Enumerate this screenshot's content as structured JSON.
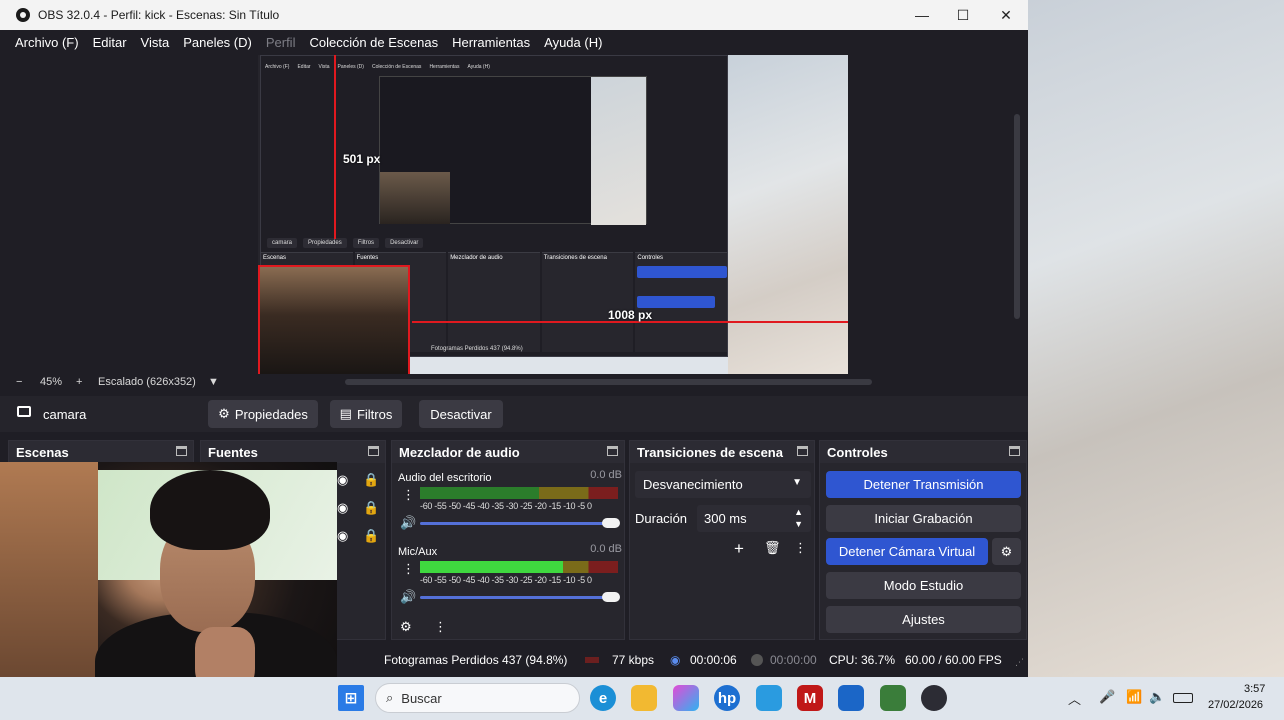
{
  "window": {
    "title": "OBS 32.0.4 - Perfil: kick - Escenas: Sin Título",
    "minimize": "—",
    "maximize": "☐",
    "close": "✕"
  },
  "menu": {
    "items": [
      "Archivo (F)",
      "Editar",
      "Vista",
      "Paneles (D)",
      "Perfil",
      "Colección de Escenas",
      "Herramientas",
      "Ayuda (H)"
    ]
  },
  "preview": {
    "label_top": "501 px",
    "label_right": "1008 px",
    "nested_menu": [
      "Archivo (F)",
      "Editar",
      "Vista",
      "Paneles (D)",
      "Colección de Escenas",
      "Herramientas",
      "Ayuda (H)"
    ],
    "nested_context": [
      "camara",
      "Propiedades",
      "Filtros",
      "Desactivar"
    ],
    "nested_docks": [
      "Escenas",
      "Fuentes",
      "Mezclador de audio",
      "Transiciones de escena",
      "Controles"
    ],
    "nested_status": "Fotogramas Perdidos 437 (94.8%)"
  },
  "zoom": {
    "minus": "−",
    "level": "45%",
    "plus": "+",
    "scaled": "Escalado (626x352)",
    "dropdown": "▼"
  },
  "context": {
    "source_name": "camara",
    "properties": "Propiedades",
    "filters": "Filtros",
    "deactivate": "Desactivar"
  },
  "docks": {
    "scenes": {
      "title": "Escenas"
    },
    "sources": {
      "title": "Fuentes"
    },
    "mixer": {
      "title": "Mezclador de audio",
      "tracks": [
        {
          "name": "Audio del escritorio",
          "db": "0.0 dB",
          "ticks": "-60 -55 -50 -45 -40 -35 -30 -25 -20 -15 -10 -5 0",
          "level": 0
        },
        {
          "name": "Mic/Aux",
          "db": "0.0 dB",
          "ticks": "-60 -55 -50 -45 -40 -35 -30 -25 -20 -15 -10 -5 0",
          "level": 0.72
        }
      ]
    },
    "transitions": {
      "title": "Transiciones de escena",
      "selected": "Desvanecimiento",
      "duration_label": "Duración",
      "duration_value": "300 ms"
    },
    "controls": {
      "title": "Controles",
      "stop_stream": "Detener Transmisión",
      "start_record": "Iniciar Grabación",
      "stop_virtual_cam": "Detener Cámara Virtual",
      "studio_mode": "Modo Estudio",
      "settings": "Ajustes"
    }
  },
  "status": {
    "dropped_frames": "Fotogramas Perdidos 437 (94.8%)",
    "bitrate": "77 kbps",
    "stream_time": "00:00:06",
    "record_time": "00:00:00",
    "cpu": "CPU: 36.7%",
    "fps": "60.00 / 60.00 FPS"
  },
  "taskbar": {
    "search_placeholder": "Buscar",
    "time": "3:57",
    "date": "27/02/2026",
    "icons": [
      "windows-start-icon",
      "edge-icon",
      "file-explorer-icon",
      "copilot-icon",
      "hp-icon",
      "store-icon",
      "mcafee-icon",
      "outlook-icon",
      "app-icon",
      "obs-icon"
    ]
  },
  "colors": {
    "obs_bg": "#1f1e25",
    "dock_bg": "#27262d",
    "accent_blue": "#2f56d1",
    "guide_red": "#e0191f"
  }
}
